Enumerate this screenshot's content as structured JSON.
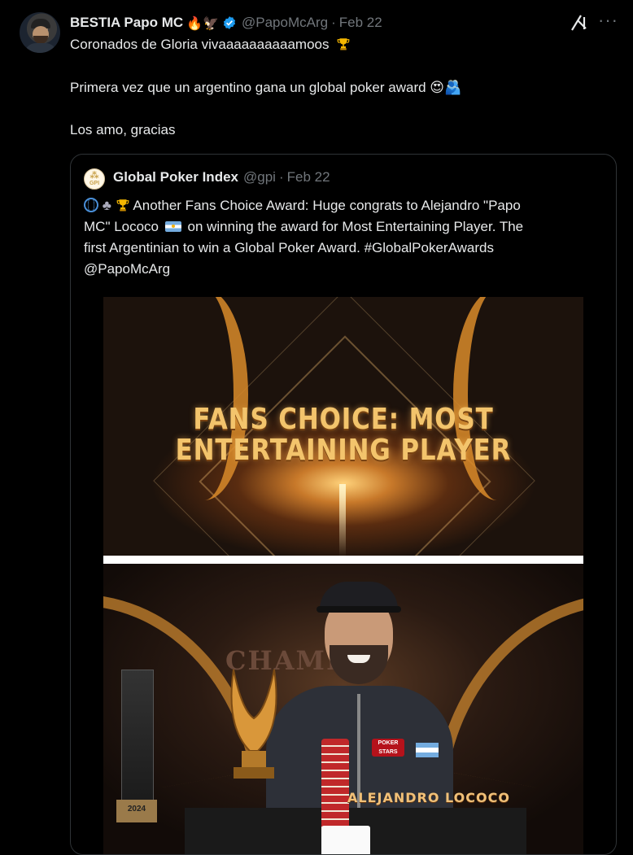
{
  "tweet": {
    "author_name": "BESTIA Papo MC",
    "author_emoji": "🔥🦅",
    "handle": "@PapoMcArg",
    "date": "Feb 22",
    "lines": [
      "Coronados de Gloria vivaaaaaaaaaamoos",
      "Primera vez que un argentino gana un global poker award",
      "Los amo, gracias"
    ],
    "line2_emoji": "😍🫂",
    "more_label": "···"
  },
  "quote": {
    "author_name": "Global Poker Index",
    "avatar_text": "GPI",
    "handle": "@gpi",
    "date": "Feb 22",
    "lines": [
      "Another Fans Choice Award: Huge congrats to Alejandro \"Papo",
      "MC\" Lococo",
      "on winning the award for Most Entertaining Player. The",
      "first Argentinian to win a Global Poker Award. #GlobalPokerAwards",
      "@PapoMcArg"
    ],
    "media": {
      "banner_line1": "FANS CHOICE: MOST",
      "banner_line2": "ENTERTAINING PLAYER",
      "champ_text": "CHAMP",
      "nameplate": "ALEJANDRO LOCOCO",
      "plaque_year": "2024",
      "badge_text": "POKER STARS"
    }
  },
  "icons": {
    "verified": "verified-badge-icon",
    "grok": "grok-icon",
    "more": "more-icon",
    "trophy": "trophy-icon",
    "globe": "globe-icon",
    "club": "club-icon",
    "flag": "argentina-flag-icon"
  },
  "colors": {
    "background": "#000000",
    "text": "#e7e9ea",
    "muted": "#71767b",
    "border": "#2f3336",
    "verified": "#1d9bf0"
  }
}
